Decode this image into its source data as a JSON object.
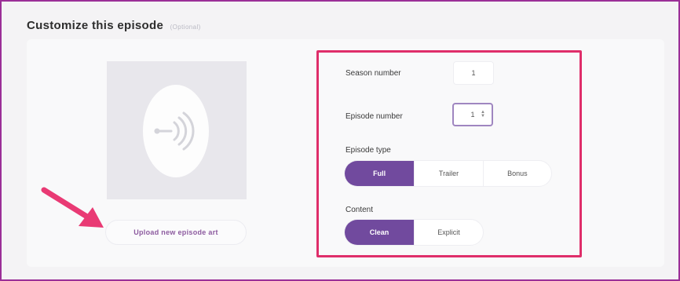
{
  "section": {
    "title": "Customize this episode",
    "optional": "(Optional)"
  },
  "art": {
    "upload_label": "Upload new episode art"
  },
  "season": {
    "label": "Season number",
    "value": "1"
  },
  "episode": {
    "label": "Episode number",
    "value": "1"
  },
  "episode_type": {
    "label": "Episode type",
    "options": [
      "Full",
      "Trailer",
      "Bonus"
    ],
    "selected": "Full"
  },
  "content": {
    "label": "Content",
    "options": [
      "Clean",
      "Explicit"
    ],
    "selected": "Clean"
  },
  "colors": {
    "accent": "#714a9e",
    "highlight": "#df2e6a",
    "arrow": "#e93a74",
    "frame": "#9b2f97"
  },
  "icons": {
    "art_placeholder": "podcast-broadcast-icon",
    "annotation": "pointer-arrow-icon",
    "stepper": "stepper-arrows-icon"
  }
}
